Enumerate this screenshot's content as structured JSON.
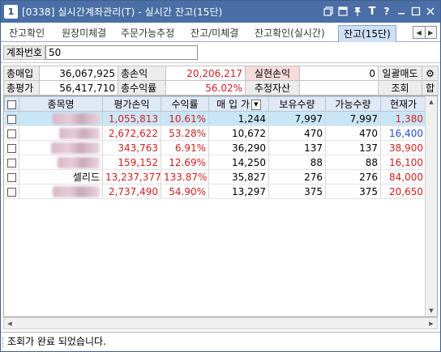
{
  "window": {
    "number": "1",
    "title": "[0338] 실시간계좌관리(T) - 실시간 잔고(15단)",
    "buttons": [
      "restore-icon",
      "window-icon",
      "pin-icon",
      "font-icon",
      "help-icon",
      "minimize-icon",
      "maximize-icon",
      "close-icon"
    ]
  },
  "tabs": [
    {
      "label": "잔고확인",
      "active": false
    },
    {
      "label": "원장미체결",
      "active": false
    },
    {
      "label": "주문가능추정",
      "active": false
    },
    {
      "label": "잔고/미체결",
      "active": false
    },
    {
      "label": "잔고확인(실시간)",
      "active": false
    },
    {
      "label": "잔고(15단)",
      "active": true
    }
  ],
  "account": {
    "label": "계좌번호",
    "value": "50"
  },
  "summary": {
    "total_purchase_label": "총매입",
    "total_purchase": "36,067,925",
    "total_pnl_label": "총손익",
    "total_pnl": "20,206,217",
    "realized_label": "실현손익",
    "realized": "0",
    "bulk_sell_label": "일괄매도",
    "total_eval_label": "총평가",
    "total_eval": "56,417,710",
    "total_return_label": "총수익률",
    "total_return": "56.02%",
    "est_assets_label": "추정자산",
    "est_assets": "",
    "query_label": "조회",
    "sum_label": "합"
  },
  "grid": {
    "headers": [
      "종목명",
      "평가손익",
      "수익률",
      "매 입 가",
      "보유수량",
      "가능수량",
      "현재가"
    ],
    "rows": [
      {
        "name": "",
        "pnl": "1,055,813",
        "rate": "10.61%",
        "buy": "1,244",
        "hold": "7,997",
        "avail": "7,997",
        "price": "1,380",
        "price_color": "red",
        "selected": true
      },
      {
        "name": "",
        "pnl": "2,672,622",
        "rate": "53.28%",
        "buy": "10,672",
        "hold": "470",
        "avail": "470",
        "price": "16,400",
        "price_color": "blue",
        "selected": false
      },
      {
        "name": "",
        "pnl": "343,763",
        "rate": "6.91%",
        "buy": "36,290",
        "hold": "137",
        "avail": "137",
        "price": "38,900",
        "price_color": "red",
        "selected": false
      },
      {
        "name": "",
        "pnl": "159,152",
        "rate": "12.69%",
        "buy": "14,250",
        "hold": "88",
        "avail": "88",
        "price": "16,100",
        "price_color": "red",
        "selected": false
      },
      {
        "name": "셀리드",
        "pnl": "13,237,377",
        "rate": "133.87%",
        "buy": "35,827",
        "hold": "276",
        "avail": "276",
        "price": "84,000",
        "price_color": "red",
        "selected": false
      },
      {
        "name": "",
        "pnl": "2,737,490",
        "rate": "54.90%",
        "buy": "13,297",
        "hold": "375",
        "avail": "375",
        "price": "20,650",
        "price_color": "red",
        "selected": false
      }
    ]
  },
  "status": {
    "message": "조회가 완료 되었습니다."
  }
}
